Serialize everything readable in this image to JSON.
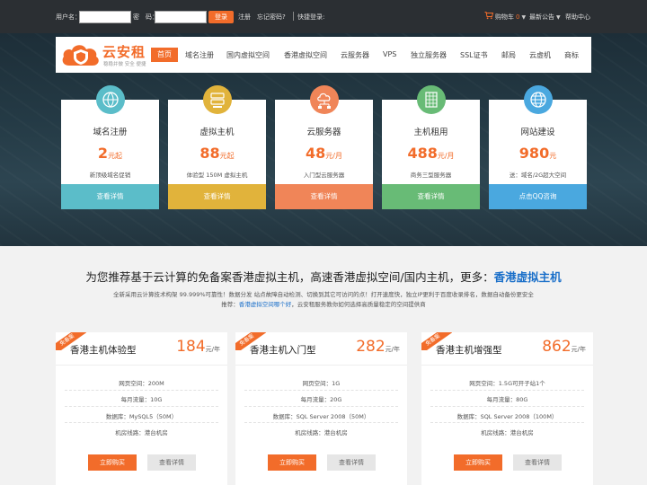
{
  "topbar": {
    "username_label": "用户名：",
    "password_label": "密　码：",
    "login_button": "登录",
    "register": "注册",
    "forgot": "忘记密码?",
    "quick_login": "快捷登录:",
    "cart": "购物车",
    "cart_count": "0",
    "news": "最新公告",
    "help": "帮助中心"
  },
  "nav": {
    "logo_title": "云安租",
    "logo_subtitle": "稳稳并做 安全 便捷",
    "home": "首页",
    "items": [
      "域名注册",
      "国内虚拟空间",
      "香港虚拟空间",
      "云服务器",
      "VPS",
      "独立服务器",
      "SSL证书",
      "邮局",
      "云虚机",
      "商标"
    ]
  },
  "products": [
    {
      "name": "域名注册",
      "price": "2",
      "unit": "元起",
      "desc": "新顶级域名促销",
      "button": "查看详情",
      "color": "#5bbdc9",
      "icon": "globe-tag-icon"
    },
    {
      "name": "虚拟主机",
      "price": "88",
      "unit": "元起",
      "desc": "体验型 150M 虚拟主机",
      "button": "查看详情",
      "color": "#e1b33b",
      "icon": "server-stack-icon"
    },
    {
      "name": "云服务器",
      "price": "48",
      "unit": "元/月",
      "desc": "入门型云服务器",
      "button": "查看详情",
      "color": "#f08558",
      "icon": "cloud-network-icon"
    },
    {
      "name": "主机租用",
      "price": "488",
      "unit": "元/月",
      "desc": "商务三型服务器",
      "button": "查看详情",
      "color": "#68bb76",
      "icon": "server-rack-icon"
    },
    {
      "name": "网站建设",
      "price": "980",
      "unit": "元",
      "desc": "送：域名/2G超大空间",
      "button": "点击QQ咨询",
      "color": "#4aa8df",
      "icon": "globe-icon"
    }
  ],
  "promo": {
    "title": "为您推荐基于云计算的免备案香港虚拟主机，高速香港虚拟空间/国内主机，更多：",
    "title_link": "香港虚拟主机",
    "line1": "全新采用云计算技术构架 99.999%可靠性！数据分发 站点故障自动检测、切换到其它可访问的点！打开速度快，独立IP更利于百度收录排名，数据自动备份更安全",
    "line2_prefix": "推荐：",
    "line2_link": "香港虚拟空间哪个好",
    "line2_suffix": "，云安租服务教你如何选择高质量稳定的空间提供商"
  },
  "plans": [
    {
      "ribbon": "免备案",
      "title": "香港主机体验型",
      "price": "184",
      "unit": "元/年",
      "features": [
        "网页空间：200M",
        "每月流量：10G",
        "数据库：MySQL5（50M）",
        "机房线路：港台机房"
      ],
      "buy": "立即购买",
      "detail": "查看详情"
    },
    {
      "ribbon": "免备案",
      "title": "香港主机入门型",
      "price": "282",
      "unit": "元/年",
      "features": [
        "网页空间：1G",
        "每月流量：20G",
        "数据库：SQL Server 2008（50M）",
        "机房线路：港台机房"
      ],
      "buy": "立即购买",
      "detail": "查看详情"
    },
    {
      "ribbon": "免备案",
      "title": "香港主机增强型",
      "price": "862",
      "unit": "元/年",
      "features": [
        "网页空间：1.5G可开子站1个",
        "每月流量：80G",
        "数据库：SQL Server 2008（100M）",
        "机房线路：港台机房"
      ],
      "buy": "立即购买",
      "detail": "查看详情"
    }
  ]
}
